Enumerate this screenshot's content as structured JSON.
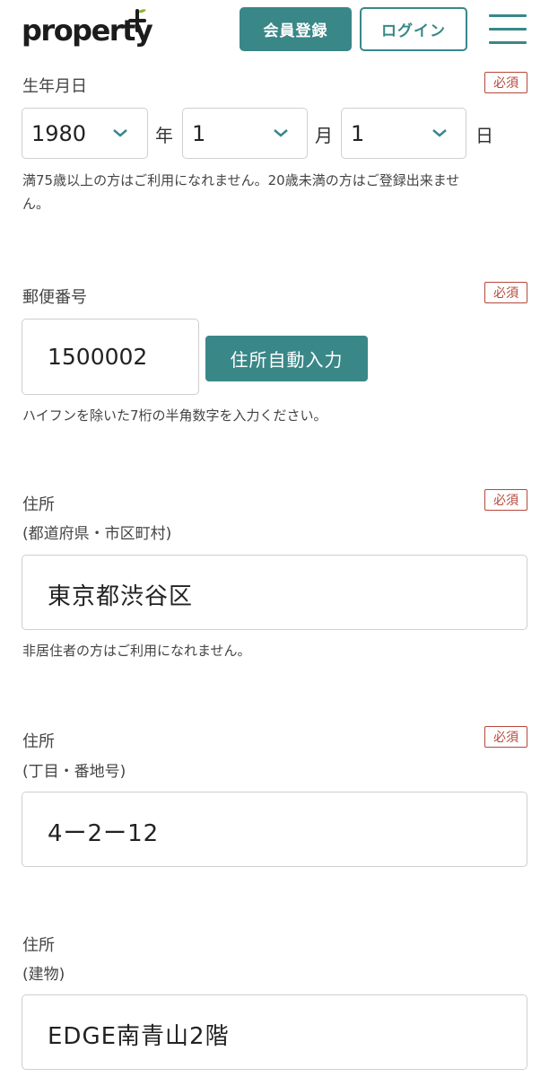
{
  "header": {
    "logo": "property",
    "register_label": "会員登録",
    "login_label": "ログイン"
  },
  "required_badge": "必須",
  "birthdate": {
    "label": "生年月日",
    "year": "1980",
    "year_unit": "年",
    "month": "1",
    "month_unit": "月",
    "day": "1",
    "day_unit": "日",
    "note_line1": "満75歳以上の方はご利用になれません。20歳未満の方はご登録出来ませ",
    "note_line2": "ん。"
  },
  "postal": {
    "label": "郵便番号",
    "value": "1500002",
    "button": "住所自動入力",
    "note": "ハイフンを除いた7桁の半角数字を入力ください。"
  },
  "address1": {
    "label": "住所",
    "sublabel": "(都道府県・市区町村)",
    "value": "東京都渋谷区",
    "note": "非居住者の方はご利用になれません。"
  },
  "address2": {
    "label": "住所",
    "sublabel": "(丁目・番地号)",
    "value": "4ー2ー12"
  },
  "address3": {
    "label": "住所",
    "sublabel": "(建物)",
    "value": "EDGE南青山2階"
  },
  "colors": {
    "accent": "#3a8788",
    "required": "#b5483b",
    "logo_plus": "#8fb43a"
  }
}
